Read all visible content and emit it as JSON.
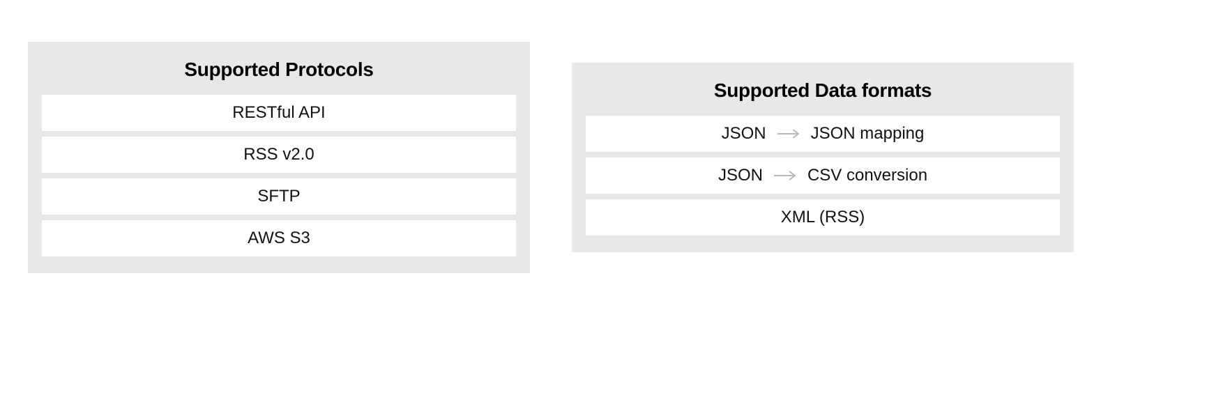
{
  "panels": {
    "protocols": {
      "title": "Supported Protocols",
      "items": [
        {
          "text": "RESTful API"
        },
        {
          "text": "RSS v2.0"
        },
        {
          "text": "SFTP"
        },
        {
          "text": "AWS S3"
        }
      ]
    },
    "formats": {
      "title": "Supported Data formats",
      "items": [
        {
          "from": "JSON",
          "to": "JSON mapping",
          "arrow": true
        },
        {
          "from": "JSON",
          "to": "CSV conversion",
          "arrow": true
        },
        {
          "text": "XML (RSS)"
        }
      ]
    }
  }
}
